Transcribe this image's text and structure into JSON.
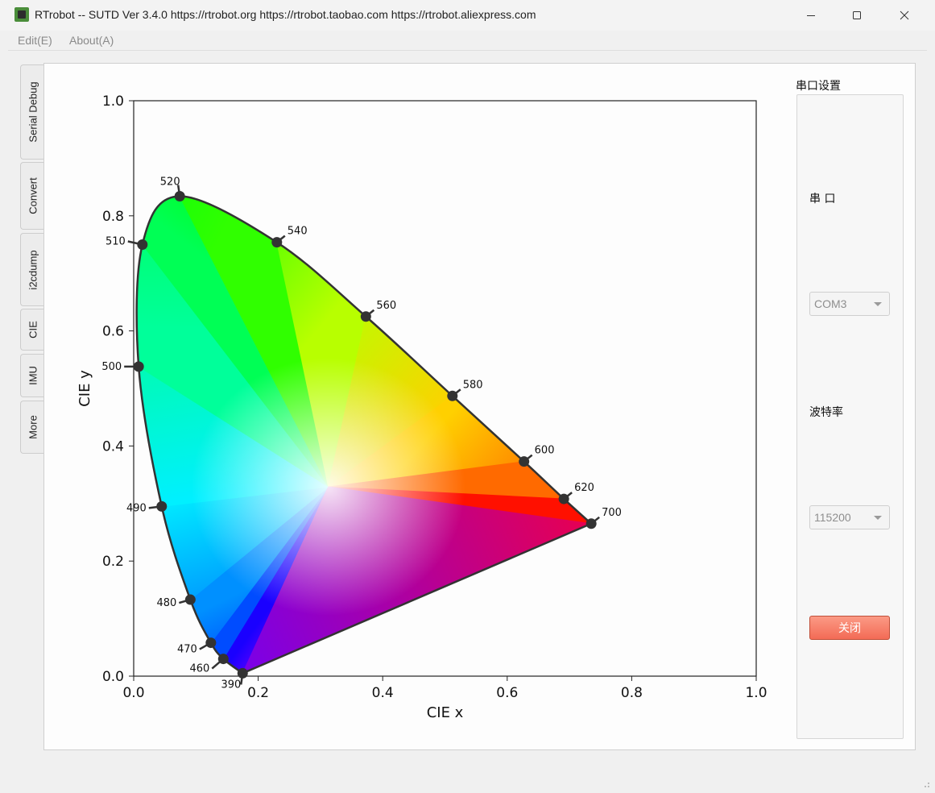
{
  "window": {
    "title": "RTrobot -- SUTD Ver 3.4.0  https://rtrobot.org  https://rtrobot.taobao.com  https://rtrobot.aliexpress.com"
  },
  "menu": {
    "items": [
      "Edit(E)",
      "About(A)"
    ]
  },
  "tabs": [
    "Serial Debug",
    "Convert",
    "i2cdump",
    "CIE",
    "IMU",
    "More"
  ],
  "active_tab": "CIE",
  "serial": {
    "group_title": "串口设置",
    "port_label": "串 口",
    "port_value": "COM3",
    "baud_label": "波特率",
    "baud_value": "115200",
    "close_label": "关闭",
    "close_color": "#f36b56"
  },
  "chart_data": {
    "type": "scatter",
    "title": "",
    "xlabel": "CIE x",
    "ylabel": "CIE y",
    "xlim": [
      0.0,
      1.0
    ],
    "ylim": [
      0.0,
      1.0
    ],
    "xticks": [
      "0.0",
      "0.2",
      "0.4",
      "0.6",
      "0.8",
      "1.0"
    ],
    "yticks": [
      "0.0",
      "0.2",
      "0.4",
      "0.6",
      "0.8",
      "1.0"
    ],
    "grid": false,
    "marked_points": [
      {
        "label": "390",
        "x": 0.175,
        "y": 0.005
      },
      {
        "label": "460",
        "x": 0.144,
        "y": 0.03
      },
      {
        "label": "470",
        "x": 0.124,
        "y": 0.058
      },
      {
        "label": "480",
        "x": 0.091,
        "y": 0.133
      },
      {
        "label": "490",
        "x": 0.045,
        "y": 0.295
      },
      {
        "label": "500",
        "x": 0.008,
        "y": 0.538
      },
      {
        "label": "510",
        "x": 0.014,
        "y": 0.75
      },
      {
        "label": "520",
        "x": 0.074,
        "y": 0.834
      },
      {
        "label": "540",
        "x": 0.23,
        "y": 0.754
      },
      {
        "label": "560",
        "x": 0.373,
        "y": 0.625
      },
      {
        "label": "580",
        "x": 0.512,
        "y": 0.487
      },
      {
        "label": "600",
        "x": 0.627,
        "y": 0.373
      },
      {
        "label": "620",
        "x": 0.691,
        "y": 0.308
      },
      {
        "label": "700",
        "x": 0.735,
        "y": 0.265
      }
    ]
  }
}
